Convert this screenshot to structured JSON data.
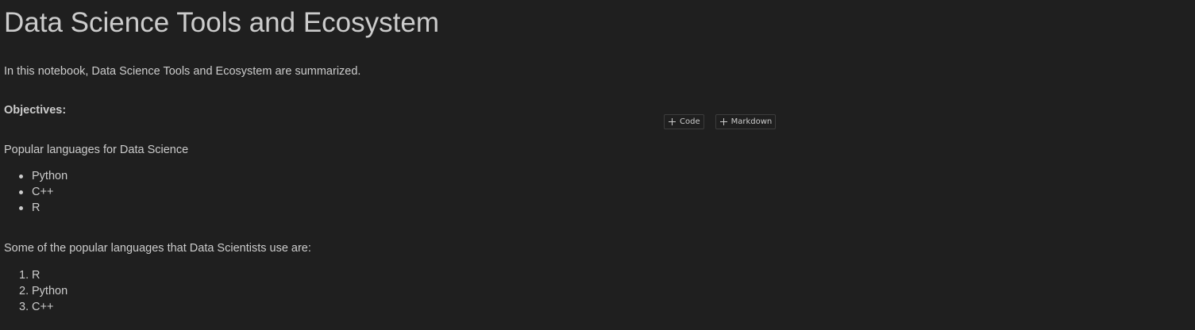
{
  "notebook": {
    "title": "Data Science Tools and Ecosystem",
    "intro": "In this notebook, Data Science Tools and Ecosystem are summarized.",
    "objectives_heading": "Objectives:",
    "popular_heading": "Popular languages for Data Science",
    "popular_list": [
      "Python",
      "C++",
      "R"
    ],
    "ranked_heading": "Some of the popular languages that Data Scientists use are:",
    "ranked_list": [
      {
        "num": "1.",
        "text": "R"
      },
      {
        "num": "2.",
        "text": "Python"
      },
      {
        "num": "3.",
        "text": "C++"
      }
    ]
  },
  "insert_toolbar": {
    "code_label": "Code",
    "markdown_label": "Markdown"
  }
}
